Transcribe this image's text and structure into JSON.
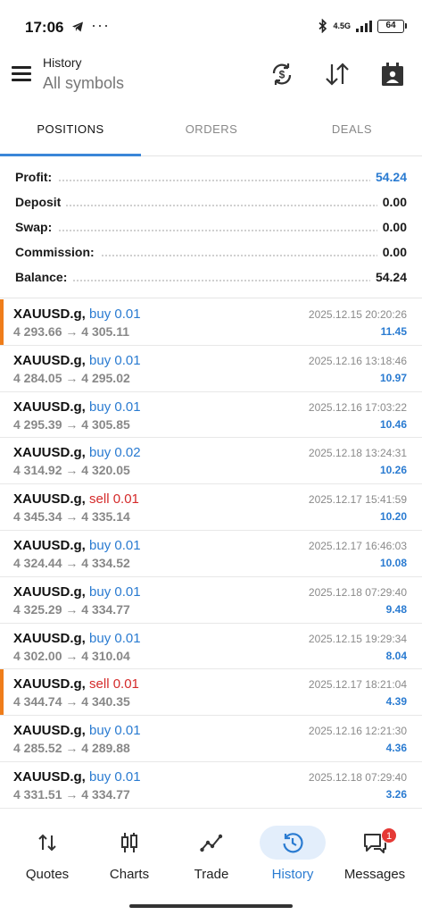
{
  "status_bar": {
    "time": "17:06",
    "network": "4.5G",
    "battery": "64"
  },
  "header": {
    "title": "History",
    "subtitle": "All symbols"
  },
  "tabs": [
    {
      "label": "POSITIONS",
      "active": true
    },
    {
      "label": "ORDERS",
      "active": false
    },
    {
      "label": "DEALS",
      "active": false
    }
  ],
  "summary": {
    "profit_label": "Profit:",
    "profit": "54.24",
    "deposit_label": "Deposit",
    "deposit": "0.00",
    "swap_label": "Swap:",
    "swap": "0.00",
    "commission_label": "Commission:",
    "commission": "0.00",
    "balance_label": "Balance:",
    "balance": "54.24"
  },
  "deals": [
    {
      "symbol": "XAUUSD.g,",
      "side": "buy 0.01",
      "type": "buy",
      "prices": "4 293.66 → 4 305.11",
      "datetime": "2025.12.15 20:20:26",
      "profit": "11.45",
      "marked": true
    },
    {
      "symbol": "XAUUSD.g,",
      "side": "buy 0.01",
      "type": "buy",
      "prices": "4 284.05 → 4 295.02",
      "datetime": "2025.12.16 13:18:46",
      "profit": "10.97",
      "marked": false
    },
    {
      "symbol": "XAUUSD.g,",
      "side": "buy 0.01",
      "type": "buy",
      "prices": "4 295.39 → 4 305.85",
      "datetime": "2025.12.16 17:03:22",
      "profit": "10.46",
      "marked": false
    },
    {
      "symbol": "XAUUSD.g,",
      "side": "buy 0.02",
      "type": "buy",
      "prices": "4 314.92 → 4 320.05",
      "datetime": "2025.12.18 13:24:31",
      "profit": "10.26",
      "marked": false
    },
    {
      "symbol": "XAUUSD.g,",
      "side": "sell 0.01",
      "type": "sell",
      "prices": "4 345.34 → 4 335.14",
      "datetime": "2025.12.17 15:41:59",
      "profit": "10.20",
      "marked": false
    },
    {
      "symbol": "XAUUSD.g,",
      "side": "buy 0.01",
      "type": "buy",
      "prices": "4 324.44 → 4 334.52",
      "datetime": "2025.12.17 16:46:03",
      "profit": "10.08",
      "marked": false
    },
    {
      "symbol": "XAUUSD.g,",
      "side": "buy 0.01",
      "type": "buy",
      "prices": "4 325.29 → 4 334.77",
      "datetime": "2025.12.18 07:29:40",
      "profit": "9.48",
      "marked": false
    },
    {
      "symbol": "XAUUSD.g,",
      "side": "buy 0.01",
      "type": "buy",
      "prices": "4 302.00 → 4 310.04",
      "datetime": "2025.12.15 19:29:34",
      "profit": "8.04",
      "marked": false
    },
    {
      "symbol": "XAUUSD.g,",
      "side": "sell 0.01",
      "type": "sell",
      "prices": "4 344.74 → 4 340.35",
      "datetime": "2025.12.17 18:21:04",
      "profit": "4.39",
      "marked": true
    },
    {
      "symbol": "XAUUSD.g,",
      "side": "buy 0.01",
      "type": "buy",
      "prices": "4 285.52 → 4 289.88",
      "datetime": "2025.12.16 12:21:30",
      "profit": "4.36",
      "marked": false
    },
    {
      "symbol": "XAUUSD.g,",
      "side": "buy 0.01",
      "type": "buy",
      "prices": "4 331.51 → 4 334.77",
      "datetime": "2025.12.18 07:29:40",
      "profit": "3.26",
      "marked": false
    }
  ],
  "bottom_nav": [
    {
      "label": "Quotes",
      "icon": "quotes-icon"
    },
    {
      "label": "Charts",
      "icon": "charts-icon"
    },
    {
      "label": "Trade",
      "icon": "trade-icon"
    },
    {
      "label": "History",
      "icon": "history-icon",
      "active": true
    },
    {
      "label": "Messages",
      "icon": "messages-icon",
      "badge": "1"
    }
  ],
  "colors": {
    "accent": "#2a7bd1",
    "sell": "#d42a2a",
    "marker": "#ef7d1a"
  }
}
